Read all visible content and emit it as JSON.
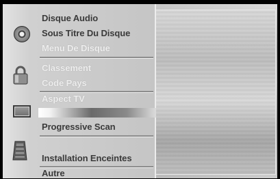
{
  "menu": {
    "items": [
      {
        "label": "Disque Audio"
      },
      {
        "label": "Sous Titre Du Disque"
      },
      {
        "label": "Menu De Disque"
      },
      {
        "label": "Classement"
      },
      {
        "label": "Code Pays"
      },
      {
        "label": "Aspect TV"
      },
      {
        "label": "Progressive Scan"
      },
      {
        "label": "Installation Enceintes"
      },
      {
        "label": "Autre"
      }
    ]
  },
  "icons": {
    "disc": "disc-icon",
    "lock": "lock-icon",
    "screen": "tv-screen-icon",
    "speaker": "speaker-icon"
  },
  "colors": {
    "menu_text": "#3a3a3a",
    "menu_text_dim": "#eeeeee",
    "panel": "#c5c5c5",
    "background": "#000000"
  }
}
